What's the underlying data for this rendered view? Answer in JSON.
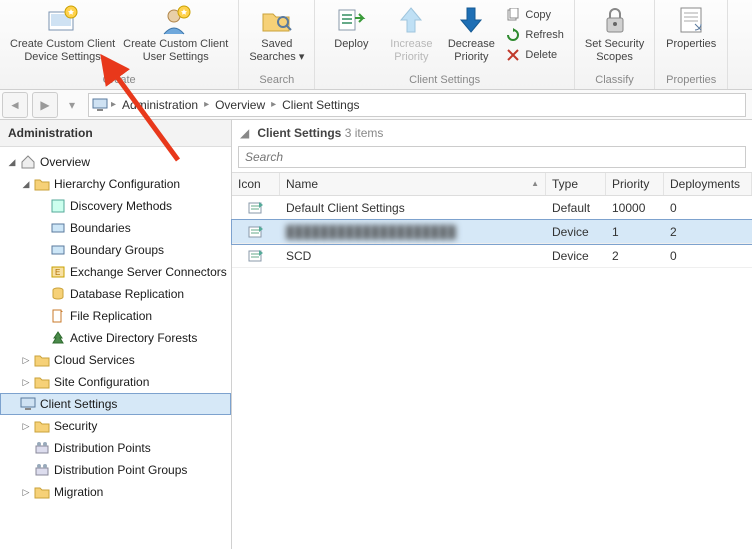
{
  "ribbon": {
    "groups": [
      {
        "label": "Create",
        "buttons": [
          {
            "name": "create-device-settings",
            "label": "Create Custom Client\nDevice Settings"
          },
          {
            "name": "create-user-settings",
            "label": "Create Custom Client\nUser Settings"
          }
        ]
      },
      {
        "label": "Search",
        "buttons": [
          {
            "name": "saved-searches",
            "label": "Saved\nSearches ▾"
          }
        ]
      },
      {
        "label": "Client Settings",
        "buttons": [
          {
            "name": "deploy",
            "label": "Deploy"
          },
          {
            "name": "increase-priority",
            "label": "Increase\nPriority",
            "disabled": true
          },
          {
            "name": "decrease-priority",
            "label": "Decrease\nPriority"
          }
        ],
        "small": [
          {
            "name": "copy",
            "label": "Copy"
          },
          {
            "name": "refresh",
            "label": "Refresh"
          },
          {
            "name": "delete",
            "label": "Delete"
          }
        ]
      },
      {
        "label": "Classify",
        "buttons": [
          {
            "name": "set-security-scopes",
            "label": "Set Security\nScopes"
          }
        ]
      },
      {
        "label": "Properties",
        "buttons": [
          {
            "name": "properties",
            "label": "Properties"
          }
        ]
      }
    ]
  },
  "breadcrumb": {
    "items": [
      "Administration",
      "Overview",
      "Client Settings"
    ]
  },
  "tree": {
    "title": "Administration",
    "nodes": [
      {
        "label": "Overview",
        "icon": "house",
        "expand": "open",
        "depth": 0
      },
      {
        "label": "Hierarchy Configuration",
        "icon": "folder",
        "expand": "open",
        "depth": 1
      },
      {
        "label": "Discovery Methods",
        "icon": "discover",
        "depth": 2
      },
      {
        "label": "Boundaries",
        "icon": "boundary",
        "depth": 2
      },
      {
        "label": "Boundary Groups",
        "icon": "boundary",
        "depth": 2
      },
      {
        "label": "Exchange Server Connectors",
        "icon": "exchange",
        "depth": 2
      },
      {
        "label": "Database Replication",
        "icon": "db",
        "depth": 2
      },
      {
        "label": "File Replication",
        "icon": "file",
        "depth": 2
      },
      {
        "label": "Active Directory Forests",
        "icon": "tree",
        "depth": 2
      },
      {
        "label": "Cloud Services",
        "icon": "folder",
        "expand": "closed",
        "depth": 1
      },
      {
        "label": "Site Configuration",
        "icon": "folder",
        "expand": "closed",
        "depth": 1
      },
      {
        "label": "Client Settings",
        "icon": "monitor",
        "depth": 1,
        "selected": true
      },
      {
        "label": "Security",
        "icon": "folder",
        "expand": "closed",
        "depth": 1
      },
      {
        "label": "Distribution Points",
        "icon": "dist",
        "depth": 1
      },
      {
        "label": "Distribution Point Groups",
        "icon": "dist",
        "depth": 1
      },
      {
        "label": "Migration",
        "icon": "folder",
        "expand": "closed",
        "depth": 1
      }
    ]
  },
  "content": {
    "title": "Client Settings",
    "count": "3 items",
    "search_placeholder": "Search",
    "columns": [
      "Icon",
      "Name",
      "Type",
      "Priority",
      "Deployments"
    ],
    "sort_col": 1,
    "rows": [
      {
        "name": "Default Client Settings",
        "type": "Default",
        "priority": "10000",
        "deployments": "0"
      },
      {
        "name": "████████████████████",
        "type": "Device",
        "priority": "1",
        "deployments": "2",
        "selected": true,
        "blur": true
      },
      {
        "name": "SCD",
        "type": "Device",
        "priority": "2",
        "deployments": "0"
      }
    ]
  }
}
